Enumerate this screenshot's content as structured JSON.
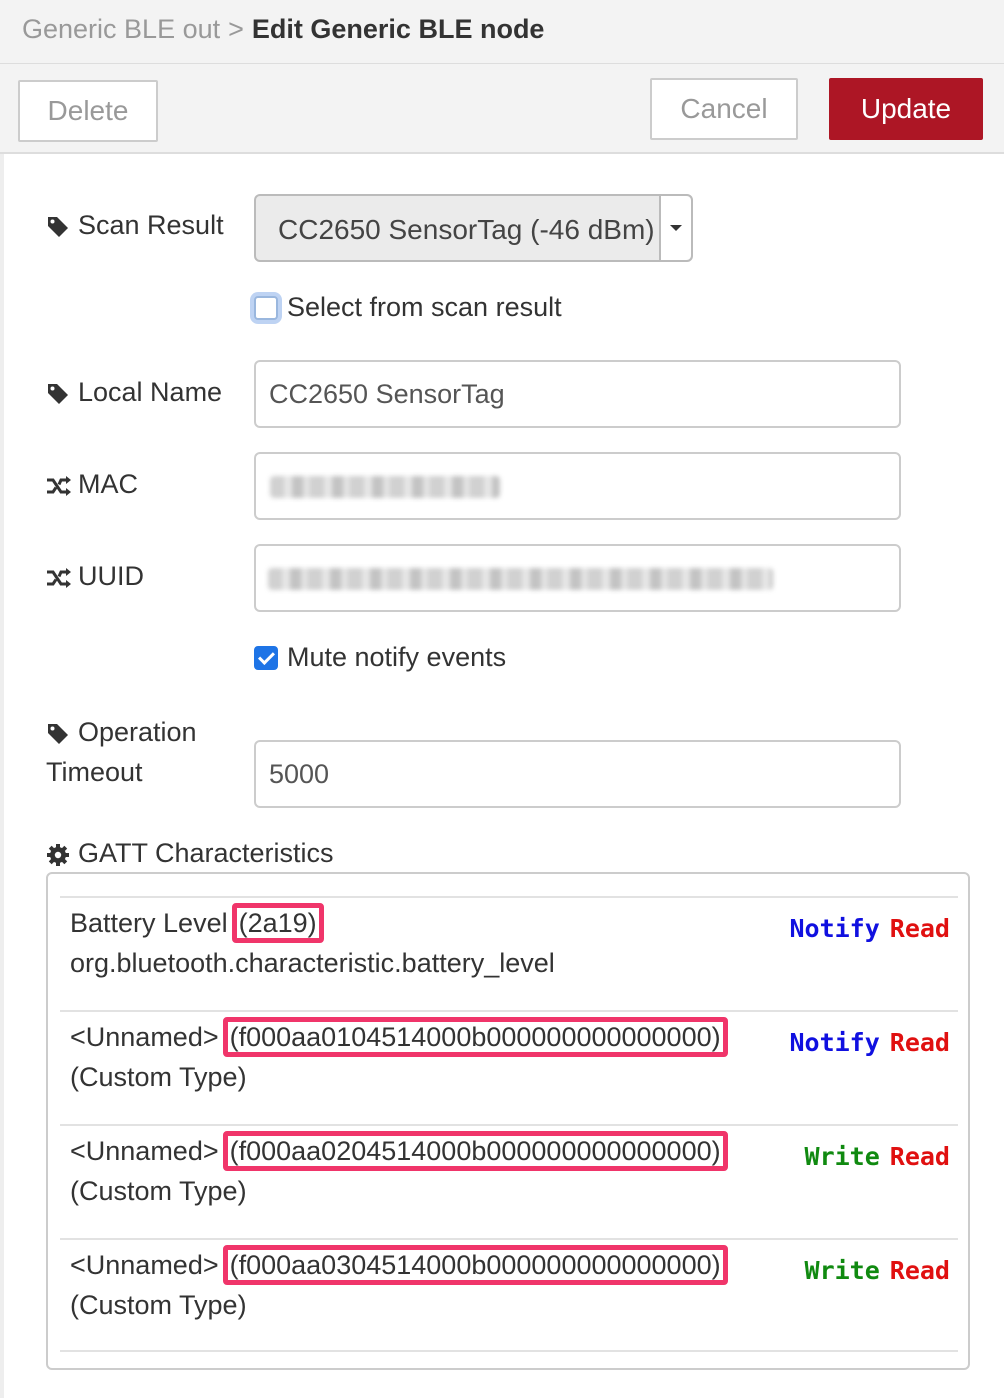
{
  "breadcrumb": {
    "parent": "Generic BLE out",
    "separator": ">",
    "current": "Edit Generic BLE node"
  },
  "toolbar": {
    "delete_label": "Delete",
    "cancel_label": "Cancel",
    "update_label": "Update"
  },
  "form": {
    "scan_result": {
      "label": "Scan Result",
      "icon": "tag-icon",
      "selected": "CC2650 SensorTag (-46 dBm)"
    },
    "select_from_scan": {
      "label": "Select from scan result",
      "checked": false
    },
    "local_name": {
      "label": "Local Name",
      "icon": "tag-icon",
      "value": "CC2650 SensorTag"
    },
    "mac": {
      "label": "MAC",
      "icon": "shuffle-icon"
    },
    "uuid": {
      "label": "UUID",
      "icon": "shuffle-icon"
    },
    "mute_notify": {
      "label": "Mute notify events",
      "checked": true
    },
    "operation_timeout": {
      "label_line1": "Operation",
      "label_line2": "Timeout",
      "icon": "tag-icon",
      "value": "5000"
    },
    "gatt": {
      "label": "GATT Characteristics",
      "icon": "gear-icon"
    }
  },
  "characteristics": [
    {
      "name": "Battery Level",
      "uuid": "(2a19)",
      "type": "org.bluetooth.characteristic.battery_level",
      "prop1": "Notify",
      "prop2": "Read"
    },
    {
      "name": "<Unnamed>",
      "uuid": "(f000aa0104514000b000000000000000)",
      "type": "(Custom Type)",
      "prop1": "Notify",
      "prop2": "Read"
    },
    {
      "name": "<Unnamed>",
      "uuid": "(f000aa0204514000b000000000000000)",
      "type": "(Custom Type)",
      "prop1": "Write",
      "prop2": "Read"
    },
    {
      "name": "<Unnamed>",
      "uuid": "(f000aa0304514000b000000000000000)",
      "type": "(Custom Type)",
      "prop1": "Write",
      "prop2": "Read"
    }
  ],
  "colors": {
    "update_button": "#ad1625",
    "highlight": "#f0356a",
    "notify": "#1010e0",
    "write": "#108a10",
    "read": "#e01010",
    "checkbox": "#1e74e6"
  }
}
